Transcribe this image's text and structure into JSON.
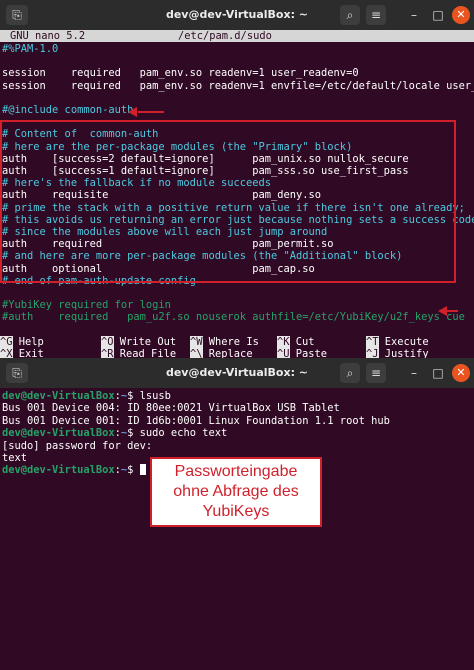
{
  "window1": {
    "title": "dev@dev-VirtualBox: ~",
    "nano_header": {
      "left": "GNU nano 5.2",
      "center": "/etc/pam.d/sudo"
    },
    "lines": [
      {
        "text": "#%PAM-1.0",
        "style": "cyan"
      },
      {
        "text": "",
        "style": ""
      },
      {
        "text": "session    required   pam_env.so readenv=1 user_readenv=0",
        "style": ""
      },
      {
        "text": "session    required   pam_env.so readenv=1 envfile=/etc/default/locale user_re",
        "style": ""
      },
      {
        "text": "",
        "style": ""
      },
      {
        "text": "#@include common-auth",
        "style": "cyan"
      },
      {
        "text": "",
        "style": ""
      },
      {
        "text": "# Content of  common-auth",
        "style": "cyan"
      },
      {
        "text": "# here are the per-package modules (the \"Primary\" block)",
        "style": "cyan"
      },
      {
        "text": "auth    [success=2 default=ignore]      pam_unix.so nullok_secure",
        "style": ""
      },
      {
        "text": "auth    [success=1 default=ignore]      pam_sss.so use_first_pass",
        "style": ""
      },
      {
        "text": "# here's the fallback if no module succeeds",
        "style": "cyan"
      },
      {
        "text": "auth    requisite                       pam_deny.so",
        "style": ""
      },
      {
        "text": "# prime the stack with a positive return value if there isn't one already;",
        "style": "cyan"
      },
      {
        "text": "# this avoids us returning an error just because nothing sets a success code",
        "style": "cyan"
      },
      {
        "text": "# since the modules above will each just jump around",
        "style": "cyan"
      },
      {
        "text": "auth    required                        pam_permit.so",
        "style": ""
      },
      {
        "text": "# and here are more per-package modules (the \"Additional\" block)",
        "style": "cyan"
      },
      {
        "text": "auth    optional                        pam_cap.so",
        "style": ""
      },
      {
        "text": "# end of pam-auth-update config",
        "style": "cyan"
      },
      {
        "text": "",
        "style": ""
      },
      {
        "text": "#YubiKey required for login",
        "style": "green"
      },
      {
        "text": "#auth    required   pam_u2f.so nouserok authfile=/etc/YubiKey/u2f_keys cue",
        "style": "green"
      }
    ],
    "shortcuts": [
      {
        "key": "^G",
        "label": "Help"
      },
      {
        "key": "^O",
        "label": "Write Out"
      },
      {
        "key": "^W",
        "label": "Where Is"
      },
      {
        "key": "^K",
        "label": "Cut"
      },
      {
        "key": "^T",
        "label": "Execute"
      },
      {
        "key": "^X",
        "label": "Exit"
      },
      {
        "key": "^R",
        "label": "Read File"
      },
      {
        "key": "^\\",
        "label": "Replace"
      },
      {
        "key": "^U",
        "label": "Paste"
      },
      {
        "key": "^J",
        "label": "Justify"
      }
    ]
  },
  "window2": {
    "title": "dev@dev-VirtualBox: ~",
    "lines": [
      {
        "prompt": "dev@dev-VirtualBox",
        "path": "~",
        "cmd": "$ lsusb"
      },
      {
        "output": "Bus 001 Device 004: ID 80ee:0021 VirtualBox USB Tablet"
      },
      {
        "output": "Bus 001 Device 001: ID 1d6b:0001 Linux Foundation 1.1 root hub"
      },
      {
        "prompt": "dev@dev-VirtualBox",
        "path": "~",
        "cmd": "$ sudo echo text"
      },
      {
        "output": "[sudo] password for dev:"
      },
      {
        "output": "text"
      },
      {
        "prompt": "dev@dev-VirtualBox",
        "path": "~",
        "cmd": "$ "
      }
    ]
  },
  "annotation": {
    "lines": [
      "Passworteingabe",
      "ohne Abfrage des",
      "YubiKeys"
    ]
  },
  "colors": {
    "terminal_bg": "#300a24",
    "titlebar_bg": "#2c2c2c",
    "comment": "#4ec9e0",
    "yubikey_comment": "#26a269",
    "prompt": "#26a269",
    "path": "#6f8fd8",
    "highlight_red": "#d0212b",
    "close_button": "#e95420"
  }
}
